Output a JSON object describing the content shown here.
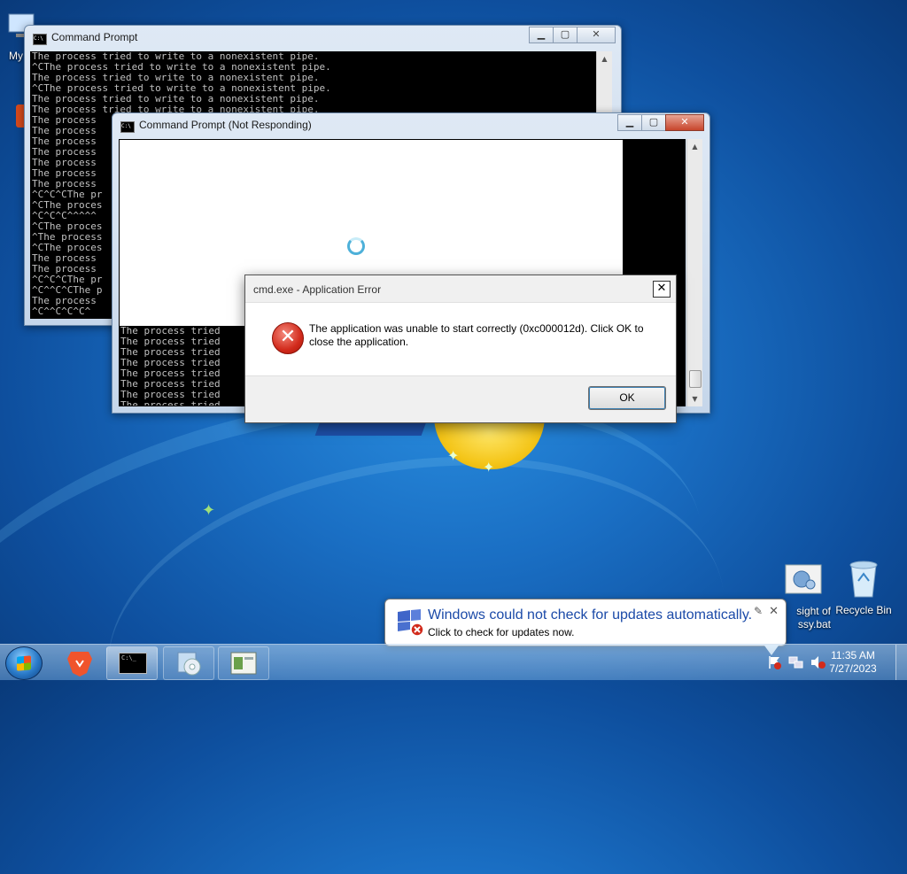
{
  "desktop": {
    "icons": [
      {
        "label": "My C",
        "icon": "computer-icon"
      },
      {
        "label": "sight of\nssy.bat",
        "icon": "batch-file-icon"
      },
      {
        "label": "Recycle Bin",
        "icon": "recycle-bin-icon"
      }
    ]
  },
  "window_back": {
    "title": "Command Prompt",
    "console_lines": [
      "The process tried to write to a nonexistent pipe.",
      "^CThe process tried to write to a nonexistent pipe.",
      "The process tried to write to a nonexistent pipe.",
      "^CThe process tried to write to a nonexistent pipe.",
      "The process tried to write to a nonexistent pipe.",
      "The process tried to write to a nonexistent pipe.",
      "The process",
      "The process",
      "The process",
      "The process",
      "The process",
      "The process",
      "The process",
      "^C^C^CThe pr",
      "^CThe proces",
      "^C^C^C^^^^^",
      "^CThe proces",
      "^The process",
      "^CThe proces",
      "The process",
      "The process",
      "^C^C^CThe pr",
      "^C^^C^CThe p",
      "The process",
      "^C^^C^C^C^"
    ]
  },
  "window_front": {
    "title": "Command Prompt (Not Responding)",
    "console_lines": [
      "The process tried",
      "The process tried",
      "The process tried",
      "The process tried",
      "The process tried",
      "The process tried",
      "The process tried",
      "The process tried"
    ]
  },
  "dialog": {
    "title": "cmd.exe - Application Error",
    "message": "The application was unable to start correctly (0xc000012d). Click OK to close the application.",
    "ok_label": "OK",
    "close_label": "✕"
  },
  "balloon": {
    "title": "Windows could not check for updates automatically.",
    "subtitle": "Click to check for updates now."
  },
  "taskbar": {
    "clock_time": "11:35 AM",
    "clock_date": "7/27/2023"
  },
  "colors": {
    "desktop_bg": "#1a6fc4",
    "error_red": "#d22b1c",
    "balloon_title": "#1b4aa8"
  }
}
